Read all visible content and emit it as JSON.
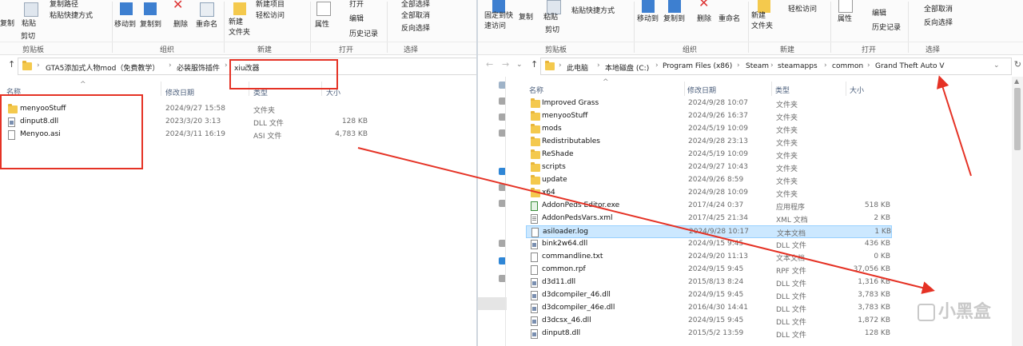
{
  "left": {
    "ribbon": {
      "copy": "复制",
      "paste": "粘贴",
      "copy_path": "复制路径",
      "paste_shortcut": "粘贴快捷方式",
      "cut": "剪切",
      "clipboard_group": "剪贴板",
      "move_to": "移动到",
      "copy_to": "复制到",
      "delete": "删除",
      "rename": "重命名",
      "organize_group": "组织",
      "new_item": "新建项目",
      "easy_access": "轻松访问",
      "new_folder": "新建\n文件夹",
      "new_group": "新建",
      "properties": "属性",
      "open": "打开",
      "edit": "编辑",
      "history": "历史记录",
      "open_group": "打开",
      "select_all": "全部选择",
      "select_none": "全部取消",
      "invert": "反向选择",
      "select_group": "选择"
    },
    "breadcrumb": [
      "GTA5添加式人物mod（免费教学）",
      "必装服饰插件",
      "xiu改器"
    ],
    "columns": [
      "名称",
      "修改日期",
      "类型",
      "大小"
    ],
    "files": [
      {
        "name": "menyooStuff",
        "date": "2024/9/27 15:58",
        "type": "文件夹",
        "size": "",
        "icon": "folder"
      },
      {
        "name": "dinput8.dll",
        "date": "2023/3/20 3:13",
        "type": "DLL 文件",
        "size": "128 KB",
        "icon": "dll"
      },
      {
        "name": "Menyoo.asi",
        "date": "2024/3/11 16:19",
        "type": "ASI 文件",
        "size": "4,783 KB",
        "icon": "file"
      }
    ]
  },
  "right": {
    "ribbon": {
      "pin": "固定到快\n速访问",
      "copy": "复制",
      "paste": "粘贴",
      "paste_shortcut": "粘贴快捷方式",
      "cut": "剪切",
      "clipboard_group": "剪贴板",
      "move_to": "移动到",
      "copy_to": "复制到",
      "delete": "删除",
      "rename": "重命名",
      "organize_group": "组织",
      "new_folder": "新建\n文件夹",
      "easy_access": "轻松访问",
      "new_group": "新建",
      "properties": "属性",
      "edit": "编辑",
      "history": "历史记录",
      "open_group": "打开",
      "select_none": "全部取消",
      "invert": "反向选择",
      "select_group": "选择"
    },
    "breadcrumb": [
      "此电脑",
      "本地磁盘 (C:)",
      "Program Files (x86)",
      "Steam",
      "steamapps",
      "common",
      "Grand Theft Auto V"
    ],
    "columns": [
      "名称",
      "修改日期",
      "类型",
      "大小"
    ],
    "files": [
      {
        "name": "Improved Grass",
        "date": "2024/9/28 10:07",
        "type": "文件夹",
        "size": "",
        "icon": "folder"
      },
      {
        "name": "menyooStuff",
        "date": "2024/9/26 16:37",
        "type": "文件夹",
        "size": "",
        "icon": "folder"
      },
      {
        "name": "mods",
        "date": "2024/5/19 10:09",
        "type": "文件夹",
        "size": "",
        "icon": "folder"
      },
      {
        "name": "Redistributables",
        "date": "2024/9/28 23:13",
        "type": "文件夹",
        "size": "",
        "icon": "folder"
      },
      {
        "name": "ReShade",
        "date": "2024/5/19 10:09",
        "type": "文件夹",
        "size": "",
        "icon": "folder"
      },
      {
        "name": "scripts",
        "date": "2024/9/27 10:43",
        "type": "文件夹",
        "size": "",
        "icon": "folder"
      },
      {
        "name": "update",
        "date": "2024/9/26 8:59",
        "type": "文件夹",
        "size": "",
        "icon": "folder"
      },
      {
        "name": "x64",
        "date": "2024/9/28 10:09",
        "type": "文件夹",
        "size": "",
        "icon": "folder"
      },
      {
        "name": "AddonPeds Editor.exe",
        "date": "2017/4/24 0:37",
        "type": "应用程序",
        "size": "518 KB",
        "icon": "exe"
      },
      {
        "name": "AddonPedsVars.xml",
        "date": "2017/4/25 21:34",
        "type": "XML 文档",
        "size": "2 KB",
        "icon": "xml"
      },
      {
        "name": "asiloader.log",
        "date": "2024/9/28 10:17",
        "type": "文本文档",
        "size": "1 KB",
        "icon": "file",
        "selected": true
      },
      {
        "name": "bink2w64.dll",
        "date": "2024/9/15 9:45",
        "type": "DLL 文件",
        "size": "436 KB",
        "icon": "dll"
      },
      {
        "name": "commandline.txt",
        "date": "2024/9/20 11:13",
        "type": "文本文档",
        "size": "0 KB",
        "icon": "file"
      },
      {
        "name": "common.rpf",
        "date": "2024/9/15 9:45",
        "type": "RPF 文件",
        "size": "37,056 KB",
        "icon": "file"
      },
      {
        "name": "d3d11.dll",
        "date": "2015/8/13 8:24",
        "type": "DLL 文件",
        "size": "1,316 KB",
        "icon": "dll"
      },
      {
        "name": "d3dcompiler_46.dll",
        "date": "2024/9/15 9:45",
        "type": "DLL 文件",
        "size": "3,783 KB",
        "icon": "dll"
      },
      {
        "name": "d3dcompiler_46e.dll",
        "date": "2016/4/30 14:41",
        "type": "DLL 文件",
        "size": "3,783 KB",
        "icon": "dll"
      },
      {
        "name": "d3dcsx_46.dll",
        "date": "2024/9/15 9:45",
        "type": "DLL 文件",
        "size": "1,872 KB",
        "icon": "dll"
      },
      {
        "name": "dinput8.dll",
        "date": "2015/5/2 13:59",
        "type": "DLL 文件",
        "size": "128 KB",
        "icon": "dll"
      }
    ]
  },
  "watermark": "小黑盒",
  "colors": {
    "annotation_red": "#e53225",
    "selection": "#cce8ff",
    "folder": "#f4c94d"
  }
}
